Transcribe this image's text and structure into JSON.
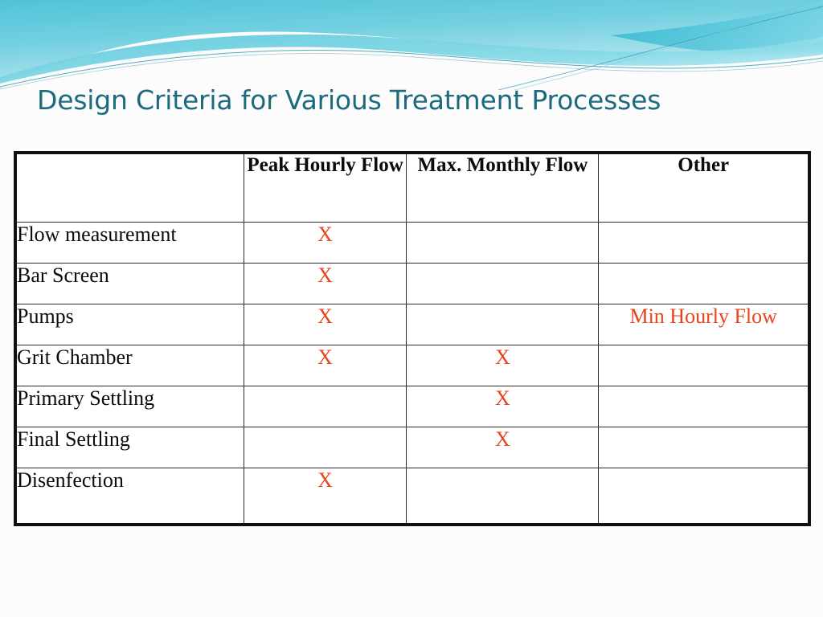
{
  "slide": {
    "title": "Design Criteria for Various Treatment Processes",
    "background_color": "#fcfcfd",
    "title_color": "#1d6a7d",
    "accent_color": "#e8431d",
    "banner_color": "#53c5dd"
  },
  "banner": {
    "name": "decorative-wave-banner"
  },
  "table": {
    "columns": [
      {
        "label": "",
        "key": "process"
      },
      {
        "label": "Peak Hourly Flow",
        "key": "peak_hourly_flow"
      },
      {
        "label": "Max. Monthly Flow",
        "key": "max_monthly_flow"
      },
      {
        "label": "Other",
        "key": "other"
      }
    ],
    "mark_symbol": "X",
    "rows": [
      {
        "process": "Flow measurement",
        "peak_hourly_flow": "X",
        "max_monthly_flow": "",
        "other": ""
      },
      {
        "process": "Bar Screen",
        "peak_hourly_flow": "X",
        "max_monthly_flow": "",
        "other": ""
      },
      {
        "process": "Pumps",
        "peak_hourly_flow": "X",
        "max_monthly_flow": "",
        "other": "Min Hourly Flow"
      },
      {
        "process": "Grit Chamber",
        "peak_hourly_flow": "X",
        "max_monthly_flow": "X",
        "other": ""
      },
      {
        "process": "Primary Settling",
        "peak_hourly_flow": "",
        "max_monthly_flow": "X",
        "other": ""
      },
      {
        "process": "Final Settling",
        "peak_hourly_flow": "",
        "max_monthly_flow": "X",
        "other": ""
      },
      {
        "process": "Disenfection",
        "peak_hourly_flow": "X",
        "max_monthly_flow": "",
        "other": ""
      }
    ]
  }
}
